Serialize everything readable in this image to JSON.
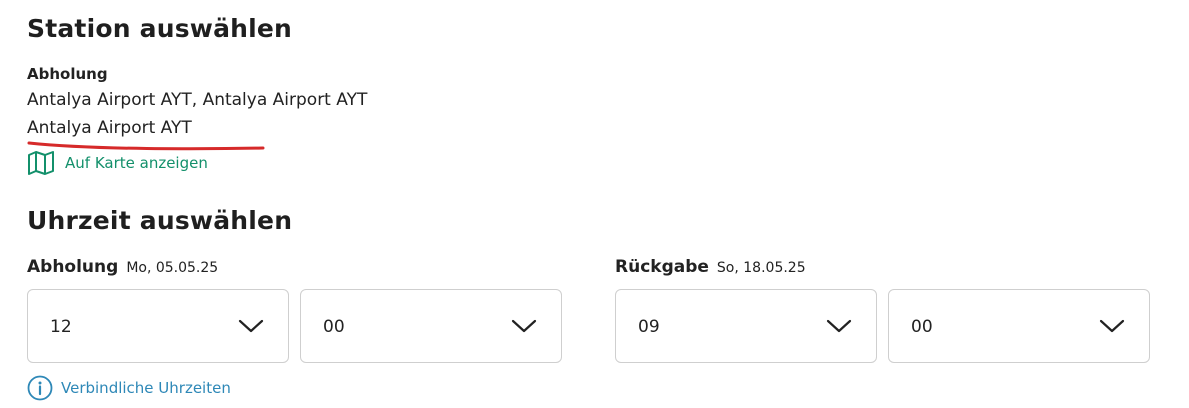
{
  "station": {
    "heading": "Station auswählen",
    "label": "Abholung",
    "line1": "Antalya Airport AYT, Antalya Airport AYT",
    "line2": "Antalya Airport AYT",
    "map_link": "Auf Karte anzeigen",
    "map_icon": "map-icon",
    "accent_color": "#13906b",
    "annotation_color": "#d62a2a"
  },
  "time": {
    "heading": "Uhrzeit auswählen",
    "pickup": {
      "label": "Abholung",
      "date": "Mo, 05.05.25",
      "hour": "12",
      "minute": "00"
    },
    "return": {
      "label": "Rückgabe",
      "date": "So, 18.05.25",
      "hour": "09",
      "minute": "00"
    },
    "info_link": "Verbindliche Uhrzeiten",
    "info_icon": "info-icon",
    "info_color": "#2e88b7"
  }
}
